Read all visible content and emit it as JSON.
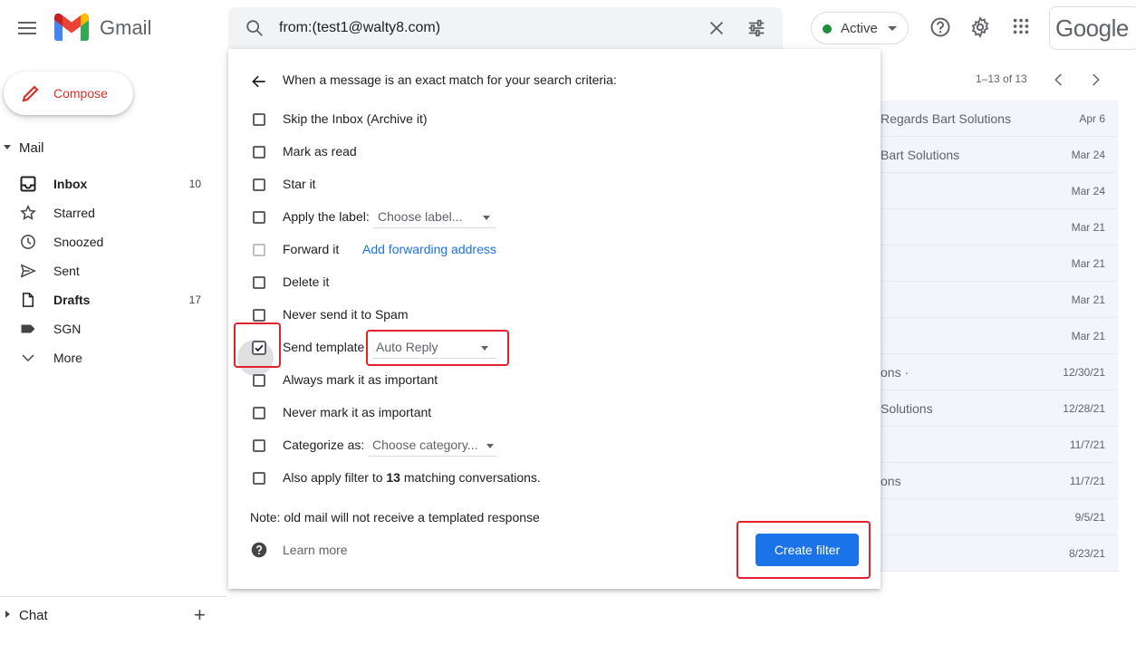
{
  "app": {
    "name": "Gmail"
  },
  "search": {
    "query": "from:(test1@walty8.com)"
  },
  "status": {
    "label": "Active",
    "color": "#1e8e3e"
  },
  "brand": {
    "google": "Google"
  },
  "compose": {
    "label": "Compose"
  },
  "sidebar": {
    "mail_section": "Mail",
    "items": [
      {
        "label": "Inbox",
        "count": "10",
        "icon": "inbox-icon",
        "bold": true
      },
      {
        "label": "Starred",
        "count": "",
        "icon": "star-icon",
        "bold": false
      },
      {
        "label": "Snoozed",
        "count": "",
        "icon": "clock-icon",
        "bold": false
      },
      {
        "label": "Sent",
        "count": "",
        "icon": "send-icon",
        "bold": false
      },
      {
        "label": "Drafts",
        "count": "17",
        "icon": "draft-icon",
        "bold": true
      },
      {
        "label": "SGN",
        "count": "",
        "icon": "label-icon",
        "bold": false
      },
      {
        "label": "More",
        "count": "",
        "icon": "chevron-down-icon",
        "bold": false
      }
    ],
    "chat_section": "Chat"
  },
  "list": {
    "pager": "1–13 of 13",
    "rows": [
      {
        "sender": "Regards Bart Solutions",
        "date": "Apr 6"
      },
      {
        "sender": "Bart Solutions",
        "date": "Mar 24"
      },
      {
        "sender": "",
        "date": "Mar 24"
      },
      {
        "sender": "",
        "date": "Mar 21"
      },
      {
        "sender": "",
        "date": "Mar 21"
      },
      {
        "sender": "",
        "date": "Mar 21"
      },
      {
        "sender": "",
        "date": "Mar 21"
      },
      {
        "sender": "ons ·",
        "date": "12/30/21"
      },
      {
        "sender": "Solutions",
        "date": "12/28/21"
      },
      {
        "sender": "",
        "date": "11/7/21"
      },
      {
        "sender": "ons",
        "date": "11/7/21"
      },
      {
        "sender": "",
        "date": "9/5/21"
      },
      {
        "sender": "",
        "date": "8/23/21"
      }
    ]
  },
  "filter": {
    "title": "When a message is an exact match for your search criteria:",
    "options": {
      "skip_inbox": "Skip the Inbox (Archive it)",
      "mark_read": "Mark as read",
      "star": "Star it",
      "apply_label": "Apply the label:",
      "label_placeholder": "Choose label...",
      "forward": "Forward it",
      "forward_link": "Add forwarding address",
      "delete": "Delete it",
      "never_spam": "Never send it to Spam",
      "send_template": "Send template",
      "template_value": "Auto Reply",
      "always_important": "Always mark it as important",
      "never_important": "Never mark it as important",
      "categorize": "Categorize as:",
      "category_placeholder": "Choose category...",
      "also_apply_prefix": "Also apply filter to ",
      "also_apply_count": "13",
      "also_apply_suffix": " matching conversations."
    },
    "note": "Note: old mail will not receive a templated response",
    "learn_more": "Learn more",
    "create_button": "Create filter"
  }
}
